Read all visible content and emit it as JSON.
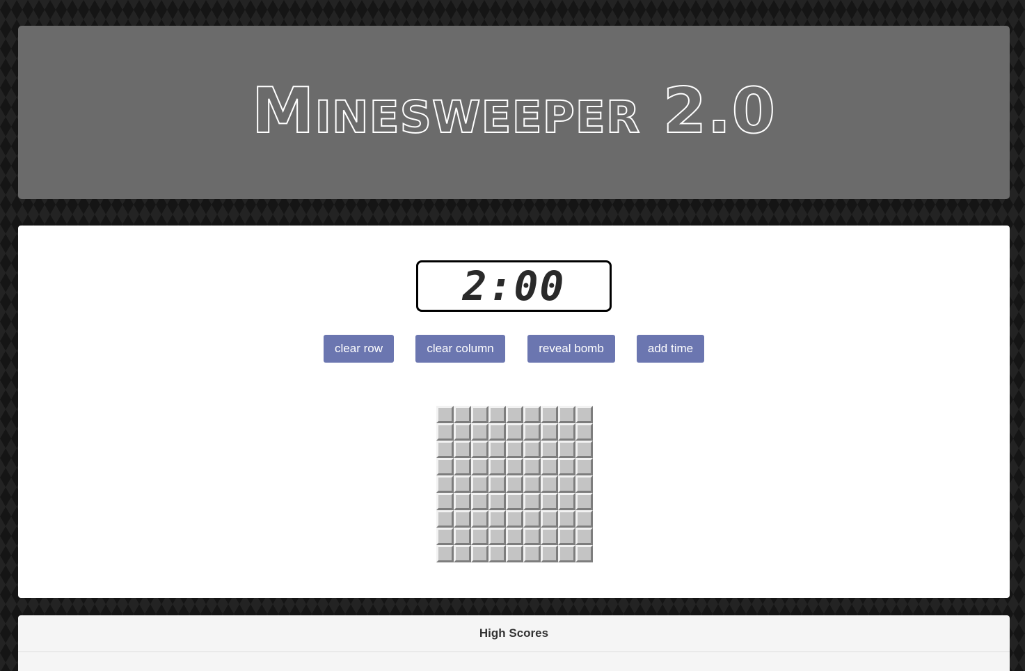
{
  "header": {
    "title": "Minesweeper 2.0"
  },
  "timer": {
    "display": "2:00"
  },
  "powerups": {
    "clear_row": "clear row",
    "clear_column": "clear column",
    "reveal_bomb": "reveal bomb",
    "add_time": "add time"
  },
  "board": {
    "rows": 9,
    "cols": 9,
    "state": "all-covered"
  },
  "high_scores": {
    "title": "High Scores"
  },
  "colors": {
    "header_bg": "#6b6b6b",
    "button_bg": "#6b76b0",
    "cell_bg": "#c4c4c4"
  }
}
